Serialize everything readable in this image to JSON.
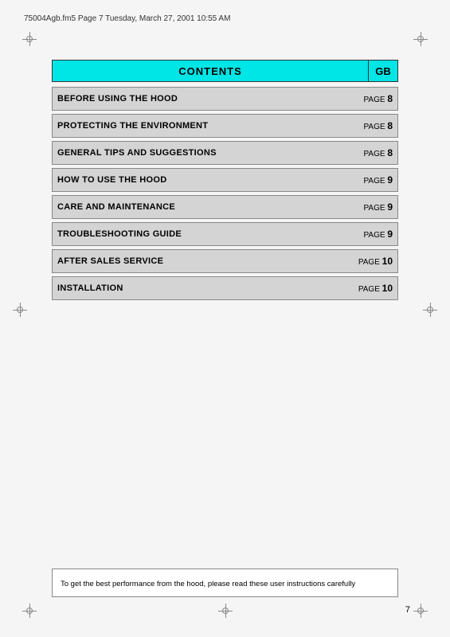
{
  "header": {
    "file_info": "75004Agb.fm5  Page 7  Tuesday, March 27, 2001  10:55 AM"
  },
  "contents": {
    "title": "CONTENTS",
    "gb_label": "GB",
    "rows": [
      {
        "label": "BEFORE USING THE HOOD",
        "page_text": "PAGE",
        "page_num": "8"
      },
      {
        "label": "PROTECTING THE ENVIRONMENT",
        "page_text": "PAGE",
        "page_num": "8"
      },
      {
        "label": "GENERAL TIPS AND SUGGESTIONS",
        "page_text": "PAGE",
        "page_num": "8"
      },
      {
        "label": "HOW TO USE THE HOOD",
        "page_text": "PAGE",
        "page_num": "9"
      },
      {
        "label": "CARE AND MAINTENANCE",
        "page_text": "PAGE",
        "page_num": "9"
      },
      {
        "label": "TROUBLESHOOTING GUIDE",
        "page_text": "PAGE",
        "page_num": "9"
      },
      {
        "label": "AFTER SALES SERVICE",
        "page_text": "PAGE",
        "page_num": "10"
      },
      {
        "label": "INSTALLATION",
        "page_text": "PAGE",
        "page_num": "10"
      }
    ]
  },
  "bottom_note": {
    "text": "To get the best performance from the hood, please read these user instructions carefully"
  },
  "page_number": "7"
}
